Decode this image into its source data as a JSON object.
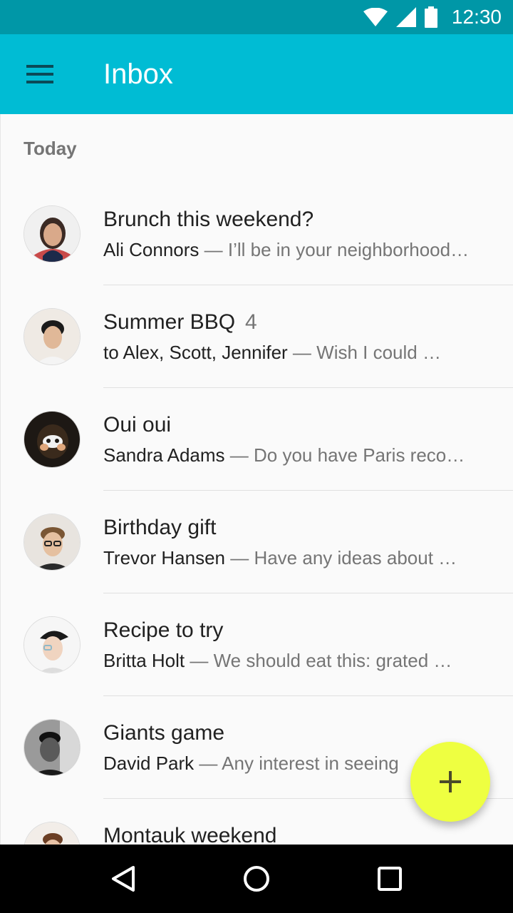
{
  "status_bar": {
    "time": "12:30"
  },
  "app_bar": {
    "title": "Inbox"
  },
  "subheader": "Today",
  "emails": [
    {
      "subject": "Brunch this weekend?",
      "count": "",
      "sender": "Ali Connors",
      "preview": " — I’ll be in your neighborhood…",
      "avatar_color": "#c94a4a"
    },
    {
      "subject": "Summer BBQ",
      "count": "4",
      "sender": "to Alex, Scott, Jennifer",
      "preview": " — Wish I could …",
      "avatar_color": "#d8cfc4"
    },
    {
      "subject": "Oui oui",
      "count": "",
      "sender": "Sandra Adams",
      "preview": " — Do you have Paris reco…",
      "avatar_color": "#2b2520"
    },
    {
      "subject": "Birthday gift",
      "count": "",
      "sender": "Trevor Hansen",
      "preview": " — Have any ideas about …",
      "avatar_color": "#8b7b6b"
    },
    {
      "subject": "Recipe to try",
      "count": "",
      "sender": "Britta Holt",
      "preview": " — We should eat this: grated …",
      "avatar_color": "#e6e6e6"
    },
    {
      "subject": "Giants game",
      "count": "",
      "sender": "David Park",
      "preview": " — Any interest in seeing",
      "avatar_color": "#3a3a3a"
    },
    {
      "subject": "Montauk weekend",
      "count": "",
      "sender": "",
      "preview": "",
      "avatar_color": "#d4b8a8"
    }
  ],
  "fab": {
    "icon": "plus-icon",
    "color": "#eeff41"
  },
  "colors": {
    "status_bar": "#0097a7",
    "app_bar": "#00bcd4"
  }
}
